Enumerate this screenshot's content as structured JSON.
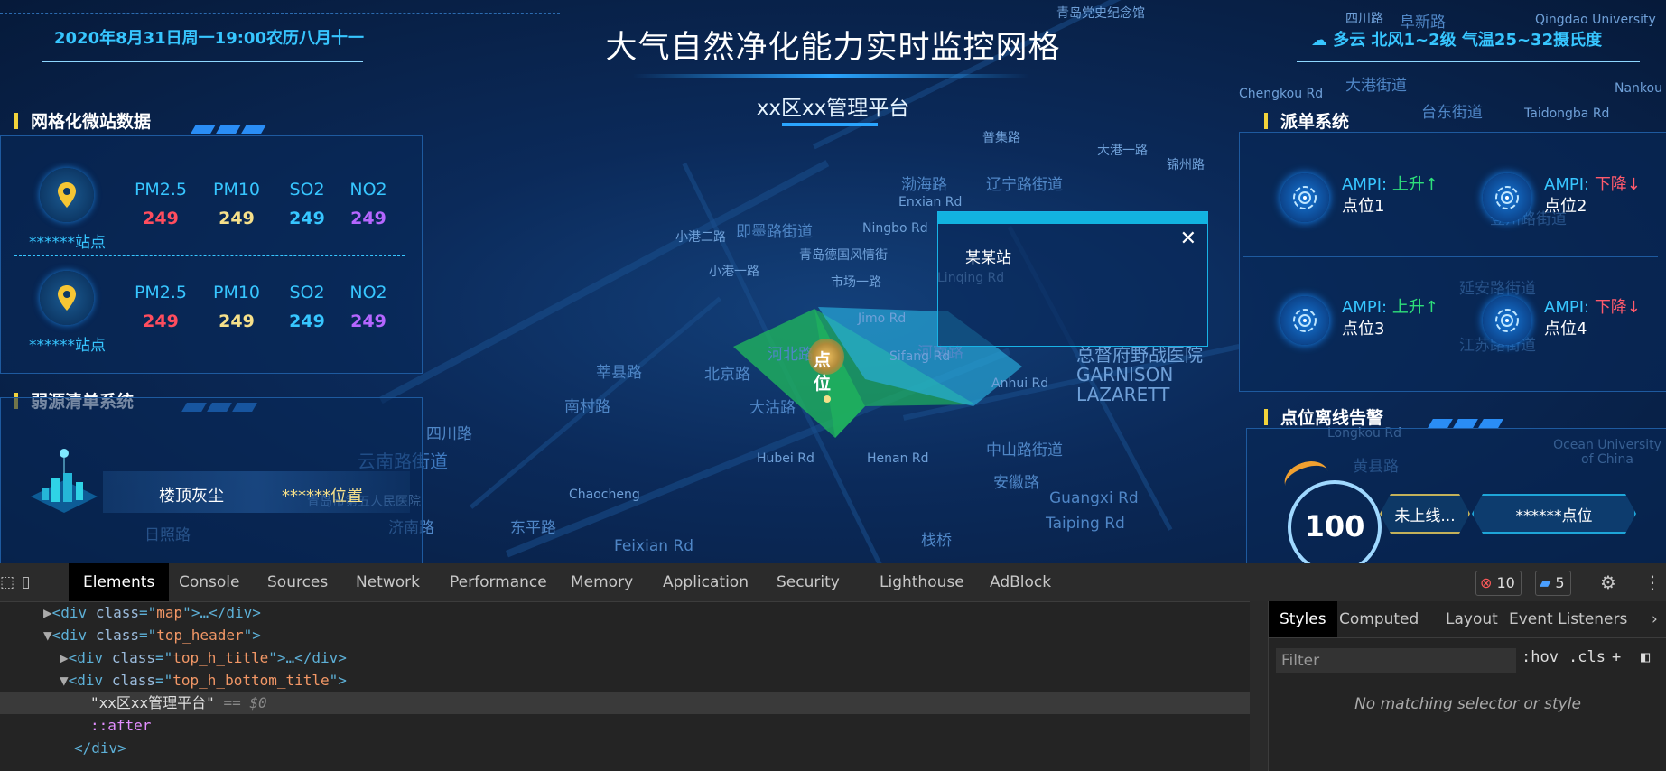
{
  "header": {
    "datetime": "2020年8月31日周一19:00农历八月十一",
    "title": "大气自然净化能力实时监控网格",
    "subtitle": "xx区xx管理平台",
    "weather": "☁ 多云  北风1~2级  气温25~32摄氏度"
  },
  "left_panel": {
    "title": "网格化微站数据",
    "stations": [
      {
        "name": "******站点",
        "metrics": [
          {
            "label": "PM2.5",
            "value": "249",
            "color": "#ff4d5e"
          },
          {
            "label": "PM10",
            "value": "249",
            "color": "#f6e08a"
          },
          {
            "label": "SO2",
            "value": "249",
            "color": "#37c6ff"
          },
          {
            "label": "NO2",
            "value": "249",
            "color": "#b566ff"
          }
        ]
      },
      {
        "name": "******站点",
        "metrics": [
          {
            "label": "PM2.5",
            "value": "249",
            "color": "#ff4d5e"
          },
          {
            "label": "PM10",
            "value": "249",
            "color": "#f6e08a"
          },
          {
            "label": "SO2",
            "value": "249",
            "color": "#37c6ff"
          },
          {
            "label": "NO2",
            "value": "249",
            "color": "#b566ff"
          }
        ]
      }
    ]
  },
  "weak_source": {
    "title": "弱源清单系统",
    "item_name": "楼顶灰尘",
    "item_position": "******位置"
  },
  "dispatch": {
    "title": "派单系统",
    "items": [
      {
        "label": "AMPI:",
        "trend": "上升↑",
        "dir": "up",
        "point": "点位1"
      },
      {
        "label": "AMPI:",
        "trend": "下降↓",
        "dir": "down",
        "point": "点位2"
      },
      {
        "label": "AMPI:",
        "trend": "上升↑",
        "dir": "up",
        "point": "点位3"
      },
      {
        "label": "AMPI:",
        "trend": "下降↓",
        "dir": "down",
        "point": "点位4"
      }
    ]
  },
  "offline_alarm": {
    "title": "点位离线告警",
    "count": "100",
    "status": "未上线...",
    "position": "******点位"
  },
  "popup": {
    "station": "某某站",
    "close": "✕"
  },
  "map": {
    "point_label": "点位",
    "places": [
      "青岛党史纪念馆",
      "四川路",
      "阜新路",
      "即墨路街道",
      "青岛德国风情街",
      "市场一路",
      "辽宁路街道",
      "大港街道",
      "台东街道",
      "登州路街道",
      "延安路街道",
      "江苏路街道",
      "中山路街道",
      "云南路街道",
      "总督府野战医院 GARNISON LAZARETT",
      "河南路",
      "莘县路",
      "南村路",
      "北京路",
      "大沽路",
      "河北路",
      "Jimo Rd",
      "Sifang Rd",
      "Anhui Rd",
      "Hubei Rd",
      "Henan Rd",
      "Feixian Rd",
      "栈桥",
      "Guangxi Rd",
      "Taiping Rd",
      "黄县路",
      "Ocean University of China",
      "Enxian Rd",
      "Ningbo Rd",
      "小港二路",
      "小港一路",
      "渤海路",
      "普集路",
      "大港一路",
      "锦州路",
      "四川路",
      "东平路",
      "Chaocheng",
      "日照路",
      "济南路",
      "Qingdao University",
      "Nankou Rd",
      "Taidongba Rd",
      "Chengkou Rd",
      "青岛市第五人民医院",
      "Longkou Rd",
      "Linqing Rd",
      "安徽路"
    ]
  },
  "devtools": {
    "tabs": [
      "Elements",
      "Console",
      "Sources",
      "Network",
      "Performance",
      "Memory",
      "Application",
      "Security",
      "Lighthouse",
      "AdBlock"
    ],
    "errors": "10",
    "messages": "5",
    "dom_lines": [
      {
        "indent": 1,
        "arrow": "▶",
        "tag": "div",
        "cls": "map",
        "tail": ">…</div>"
      },
      {
        "indent": 1,
        "arrow": "▼",
        "tag": "div",
        "cls": "top_header",
        "tail": ">"
      },
      {
        "indent": 2,
        "arrow": "▶",
        "tag": "div",
        "cls": "top_h_title",
        "tail": ">…</div>"
      },
      {
        "indent": 2,
        "arrow": "▼",
        "tag": "div",
        "cls": "top_h_bottom_title",
        "tail": ">"
      }
    ],
    "selected_text": "\"xx区xx管理平台\"",
    "selected_suffix": "== $0",
    "pseudo": "::after",
    "close_tag": "</div>",
    "styles_tabs": [
      "Styles",
      "Computed",
      "Layout",
      "Event Listeners"
    ],
    "filter_placeholder": "Filter",
    "hov": ":hov",
    "cls": ".cls",
    "no_match": "No matching selector or style"
  }
}
